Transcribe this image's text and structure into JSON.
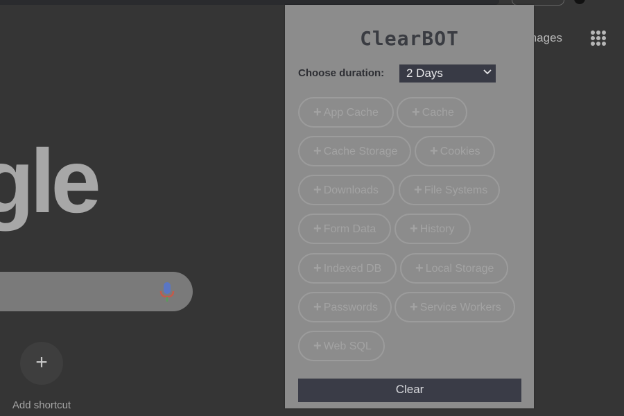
{
  "background_page": {
    "images_link": "mages",
    "logo_fragment": "gle",
    "add_shortcut_label": "Add shortcut",
    "add_shortcut_symbol": "+"
  },
  "popup": {
    "title": "ClearBOT",
    "duration_label": "Choose duration:",
    "duration_value": "2 Days",
    "options": [
      "App Cache",
      "Cache",
      "Cache Storage",
      "Cookies",
      "Downloads",
      "File Systems",
      "Form Data",
      "History",
      "Indexed DB",
      "Local Storage",
      "Passwords",
      "Service Workers",
      "Web SQL"
    ],
    "clear_label": "Clear"
  }
}
